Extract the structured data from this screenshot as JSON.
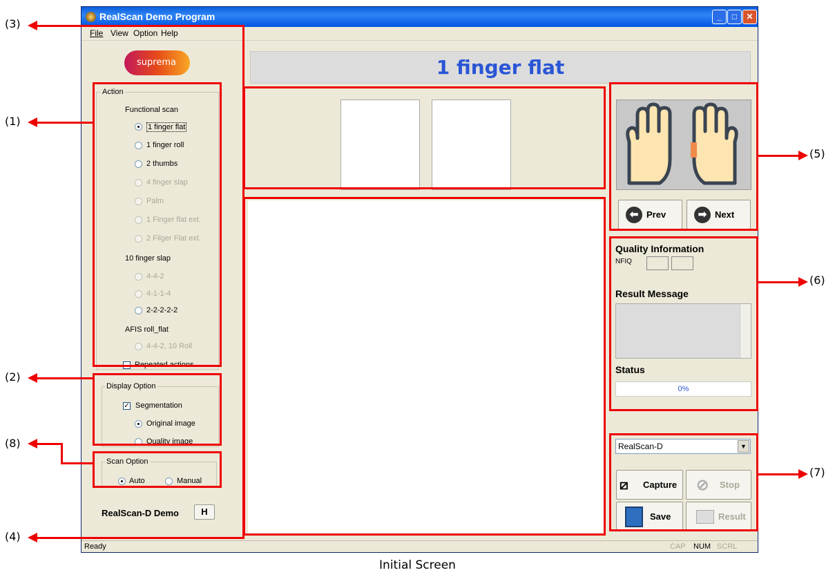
{
  "window": {
    "title": "RealScan Demo Program",
    "minimize": "_",
    "maximize": "□",
    "close": "✕"
  },
  "menu": {
    "file": "File",
    "view": "View",
    "option": "Option",
    "help": "Help"
  },
  "logo": "suprema",
  "action": {
    "legend": "Action",
    "functional_scan": "Functional scan",
    "items": [
      {
        "label": "1 finger flat",
        "checked": true,
        "enabled": true
      },
      {
        "label": "1 finger roll",
        "enabled": true
      },
      {
        "label": "2 thumbs",
        "enabled": true
      },
      {
        "label": "4 finger slap",
        "enabled": false
      },
      {
        "label": "Palm",
        "enabled": false
      },
      {
        "label": "1 Finger flat ext.",
        "enabled": false
      },
      {
        "label": "2 Filger Flat ext.",
        "enabled": false
      }
    ],
    "ten_finger_slap": "10 finger slap",
    "slap_items": [
      {
        "label": "4-4-2",
        "enabled": false
      },
      {
        "label": "4-1-1-4",
        "enabled": false
      },
      {
        "label": "2-2-2-2-2",
        "enabled": true
      }
    ],
    "afis": "AFIS roll_flat",
    "afis_item": "4-4-2, 10 Roll",
    "repeated": "Repeated actions"
  },
  "display": {
    "legend": "Display Option",
    "segmentation": "Segmentation",
    "original": "Original image",
    "quality": "Quality image"
  },
  "scan": {
    "legend": "Scan Option",
    "auto": "Auto",
    "manual": "Manual"
  },
  "device_label": "RealScan-D Demo",
  "h_button": "H",
  "mode_title": "1 finger flat",
  "nav": {
    "prev": "Prev",
    "next": "Next"
  },
  "quality": {
    "title": "Quality Information",
    "nfiq": "NFIQ",
    "result_title": "Result Message",
    "status_title": "Status",
    "progress": "0%"
  },
  "device_select": "RealScan-D",
  "actions": {
    "capture": "Capture",
    "stop": "Stop",
    "save": "Save",
    "result": "Result"
  },
  "statusbar": {
    "text": "Ready",
    "cap": "CAP",
    "num": "NUM",
    "scrl": "SCRL"
  },
  "callouts": [
    "(1)",
    "(2)",
    "(3)",
    "(4)",
    "(5)",
    "(6)",
    "(7)",
    "(8)"
  ],
  "caption": "Initial Screen",
  "colors": {
    "title_blue": "#2a56d6",
    "highlight_red": "#e00000",
    "finger_orange": "#f08a4b"
  }
}
